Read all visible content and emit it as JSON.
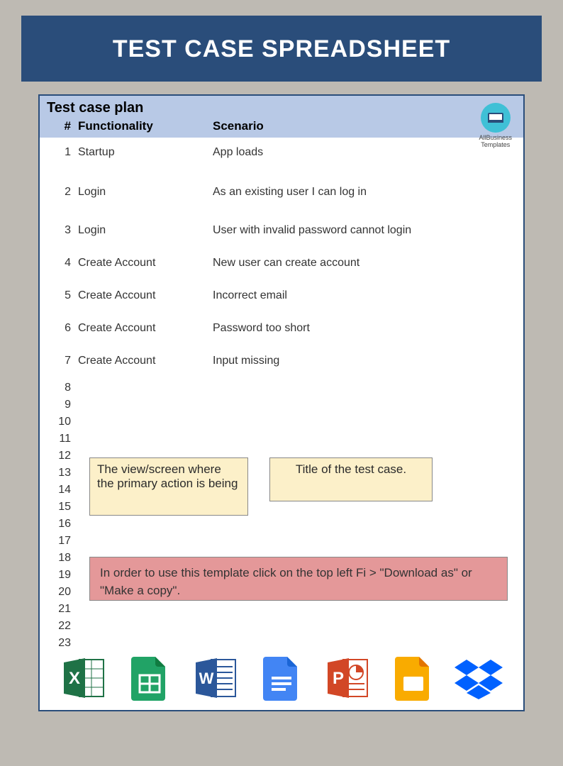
{
  "header": {
    "title": "TEST CASE SPREADSHEET"
  },
  "sheet": {
    "title": "Test case plan",
    "columns": {
      "num": "#",
      "functionality": "Functionality",
      "scenario": "Scenario"
    },
    "rows": [
      {
        "num": "1",
        "functionality": "Startup",
        "scenario": "App loads"
      },
      {
        "num": "2",
        "functionality": "Login",
        "scenario": "As an existing user I can log in"
      },
      {
        "num": "3",
        "functionality": "Login",
        "scenario": "User with invalid password cannot login"
      },
      {
        "num": "4",
        "functionality": "Create Account",
        "scenario": "New user can create account"
      },
      {
        "num": "5",
        "functionality": "Create Account",
        "scenario": "Incorrect email"
      },
      {
        "num": "6",
        "functionality": "Create Account",
        "scenario": "Password too short"
      },
      {
        "num": "7",
        "functionality": "Create Account",
        "scenario": "Input missing"
      }
    ],
    "emptyRowNumbers": [
      "8",
      "9",
      "10",
      "11",
      "12",
      "13",
      "14",
      "15",
      "16",
      "17",
      "18",
      "19",
      "20",
      "21",
      "22",
      "23"
    ]
  },
  "logo": {
    "label": "AllBusiness\nTemplates"
  },
  "notes": {
    "note1": "The view/screen where the primary action is being",
    "note2": "Title of the test case.",
    "note3": "In order to use this template click on the top left Fi > \"Download as\" or \"Make a copy\"."
  },
  "apps": {
    "excel": "Excel",
    "sheets": "Google Sheets",
    "word": "Word",
    "docs": "Google Docs",
    "powerpoint": "PowerPoint",
    "slides": "Google Slides",
    "dropbox": "Dropbox"
  },
  "colors": {
    "headerBg": "#2a4d7a",
    "tableHeaderBg": "#b8c9e6",
    "noteYellow": "#fcf0c9",
    "noteRed": "#e49899",
    "pageBg": "#bebab3"
  }
}
